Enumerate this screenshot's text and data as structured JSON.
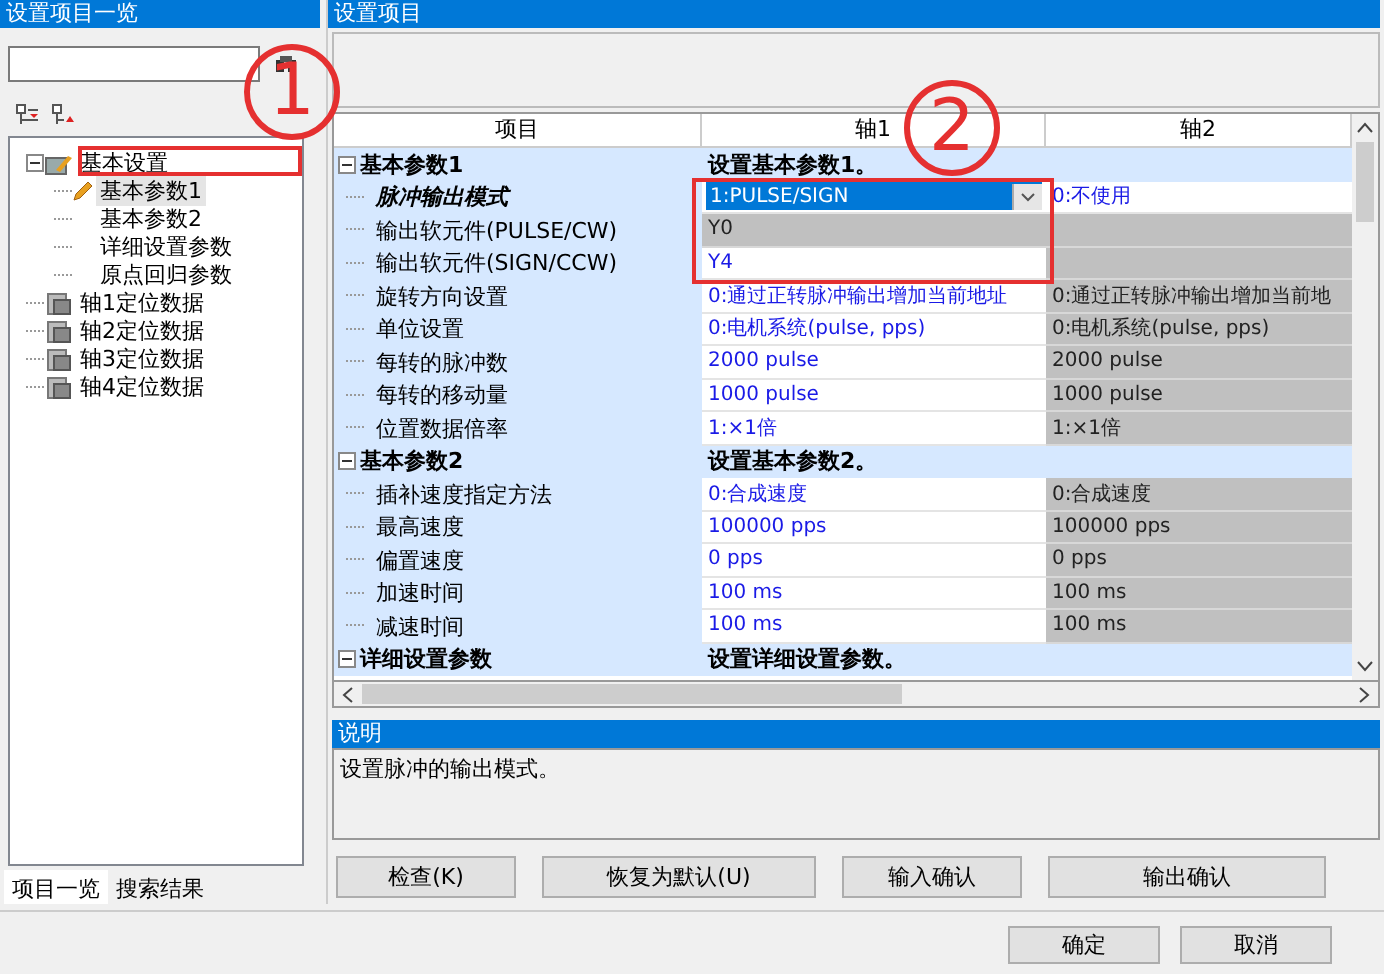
{
  "left_panel": {
    "title": "设置项目一览",
    "tree": [
      {
        "label": "基本设置",
        "expanded": true,
        "selected": false,
        "children": [
          {
            "label": "基本参数1",
            "selected": true
          },
          {
            "label": "基本参数2",
            "selected": false
          },
          {
            "label": "详细设置参数",
            "selected": false
          },
          {
            "label": "原点回归参数",
            "selected": false
          }
        ]
      },
      {
        "label": "轴1定位数据",
        "selected": false
      },
      {
        "label": "轴2定位数据",
        "selected": false
      },
      {
        "label": "轴3定位数据",
        "selected": false
      },
      {
        "label": "轴4定位数据",
        "selected": false
      }
    ],
    "tabs": [
      {
        "label": "项目一览",
        "selected": true
      },
      {
        "label": "搜索结果",
        "selected": false
      }
    ]
  },
  "right_panel": {
    "title": "设置项目",
    "grid": {
      "columns": [
        "项目",
        "轴1",
        "轴2"
      ],
      "groups": [
        {
          "label": "基本参数1",
          "description": "设置基本参数1。",
          "expanded": true,
          "rows": [
            {
              "label": "脉冲输出模式",
              "current": true,
              "cells": [
                {
                  "kind": "dropdown",
                  "text": "1:PULSE/SIGN",
                  "editable": true
                },
                {
                  "kind": "text",
                  "text": "0:不使用",
                  "editable": true
                }
              ]
            },
            {
              "label": "输出软元件(PULSE/CW)",
              "current": false,
              "cells": [
                {
                  "kind": "text",
                  "text": "Y0",
                  "editable": false
                },
                {
                  "kind": "text",
                  "editable": false
                }
              ]
            },
            {
              "label": "输出软元件(SIGN/CCW)",
              "current": false,
              "cells": [
                {
                  "kind": "text",
                  "text": "Y4",
                  "editable": true
                },
                {
                  "kind": "text",
                  "editable": false
                }
              ]
            },
            {
              "label": "旋转方向设置",
              "current": false,
              "cells": [
                {
                  "kind": "text",
                  "text": "0:通过正转脉冲输出增加当前地址",
                  "editable": true
                },
                {
                  "kind": "text",
                  "text": "0:通过正转脉冲输出增加当前地",
                  "editable": false
                }
              ]
            },
            {
              "label": "单位设置",
              "current": false,
              "cells": [
                {
                  "kind": "text",
                  "text": "0:电机系统(pulse, pps)",
                  "editable": true
                },
                {
                  "kind": "text",
                  "text": "0:电机系统(pulse, pps)",
                  "editable": false
                }
              ]
            },
            {
              "label": "每转的脉冲数",
              "current": false,
              "cells": [
                {
                  "kind": "text",
                  "text": "2000 pulse",
                  "editable": true
                },
                {
                  "kind": "text",
                  "text": "2000 pulse",
                  "editable": false
                }
              ]
            },
            {
              "label": "每转的移动量",
              "current": false,
              "cells": [
                {
                  "kind": "text",
                  "text": "1000 pulse",
                  "editable": true
                },
                {
                  "kind": "text",
                  "text": "1000 pulse",
                  "editable": false
                }
              ]
            },
            {
              "label": "位置数据倍率",
              "current": false,
              "cells": [
                {
                  "kind": "text",
                  "text": "1:×1倍",
                  "editable": true
                },
                {
                  "kind": "text",
                  "text": "1:×1倍",
                  "editable": false
                }
              ]
            }
          ]
        },
        {
          "label": "基本参数2",
          "description": "设置基本参数2。",
          "expanded": true,
          "rows": [
            {
              "label": "插补速度指定方法",
              "current": false,
              "cells": [
                {
                  "kind": "text",
                  "text": "0:合成速度",
                  "editable": true
                },
                {
                  "kind": "text",
                  "text": "0:合成速度",
                  "editable": false
                }
              ]
            },
            {
              "label": "最高速度",
              "current": false,
              "cells": [
                {
                  "kind": "text",
                  "text": "100000 pps",
                  "editable": true
                },
                {
                  "kind": "text",
                  "text": "100000 pps",
                  "editable": false
                }
              ]
            },
            {
              "label": "偏置速度",
              "current": false,
              "cells": [
                {
                  "kind": "text",
                  "text": "0 pps",
                  "editable": true
                },
                {
                  "kind": "text",
                  "text": "0 pps",
                  "editable": false
                }
              ]
            },
            {
              "label": "加速时间",
              "current": false,
              "cells": [
                {
                  "kind": "text",
                  "text": "100 ms",
                  "editable": true
                },
                {
                  "kind": "text",
                  "text": "100 ms",
                  "editable": false
                }
              ]
            },
            {
              "label": "减速时间",
              "current": false,
              "cells": [
                {
                  "kind": "text",
                  "text": "100 ms",
                  "editable": true
                },
                {
                  "kind": "text",
                  "text": "100 ms",
                  "editable": false
                }
              ]
            }
          ]
        },
        {
          "label": "详细设置参数",
          "description": "设置详细设置参数。",
          "expanded": true
        }
      ]
    },
    "description": {
      "title": "说明",
      "text": "设置脉冲的输出模式。"
    },
    "buttons": [
      "检查(K)",
      "恢复为默认(U)",
      "输入确认",
      "输出确认"
    ]
  },
  "footer_buttons": [
    "确定",
    "取消"
  ],
  "annotations": [
    {
      "label": "1"
    },
    {
      "label": "2"
    }
  ]
}
